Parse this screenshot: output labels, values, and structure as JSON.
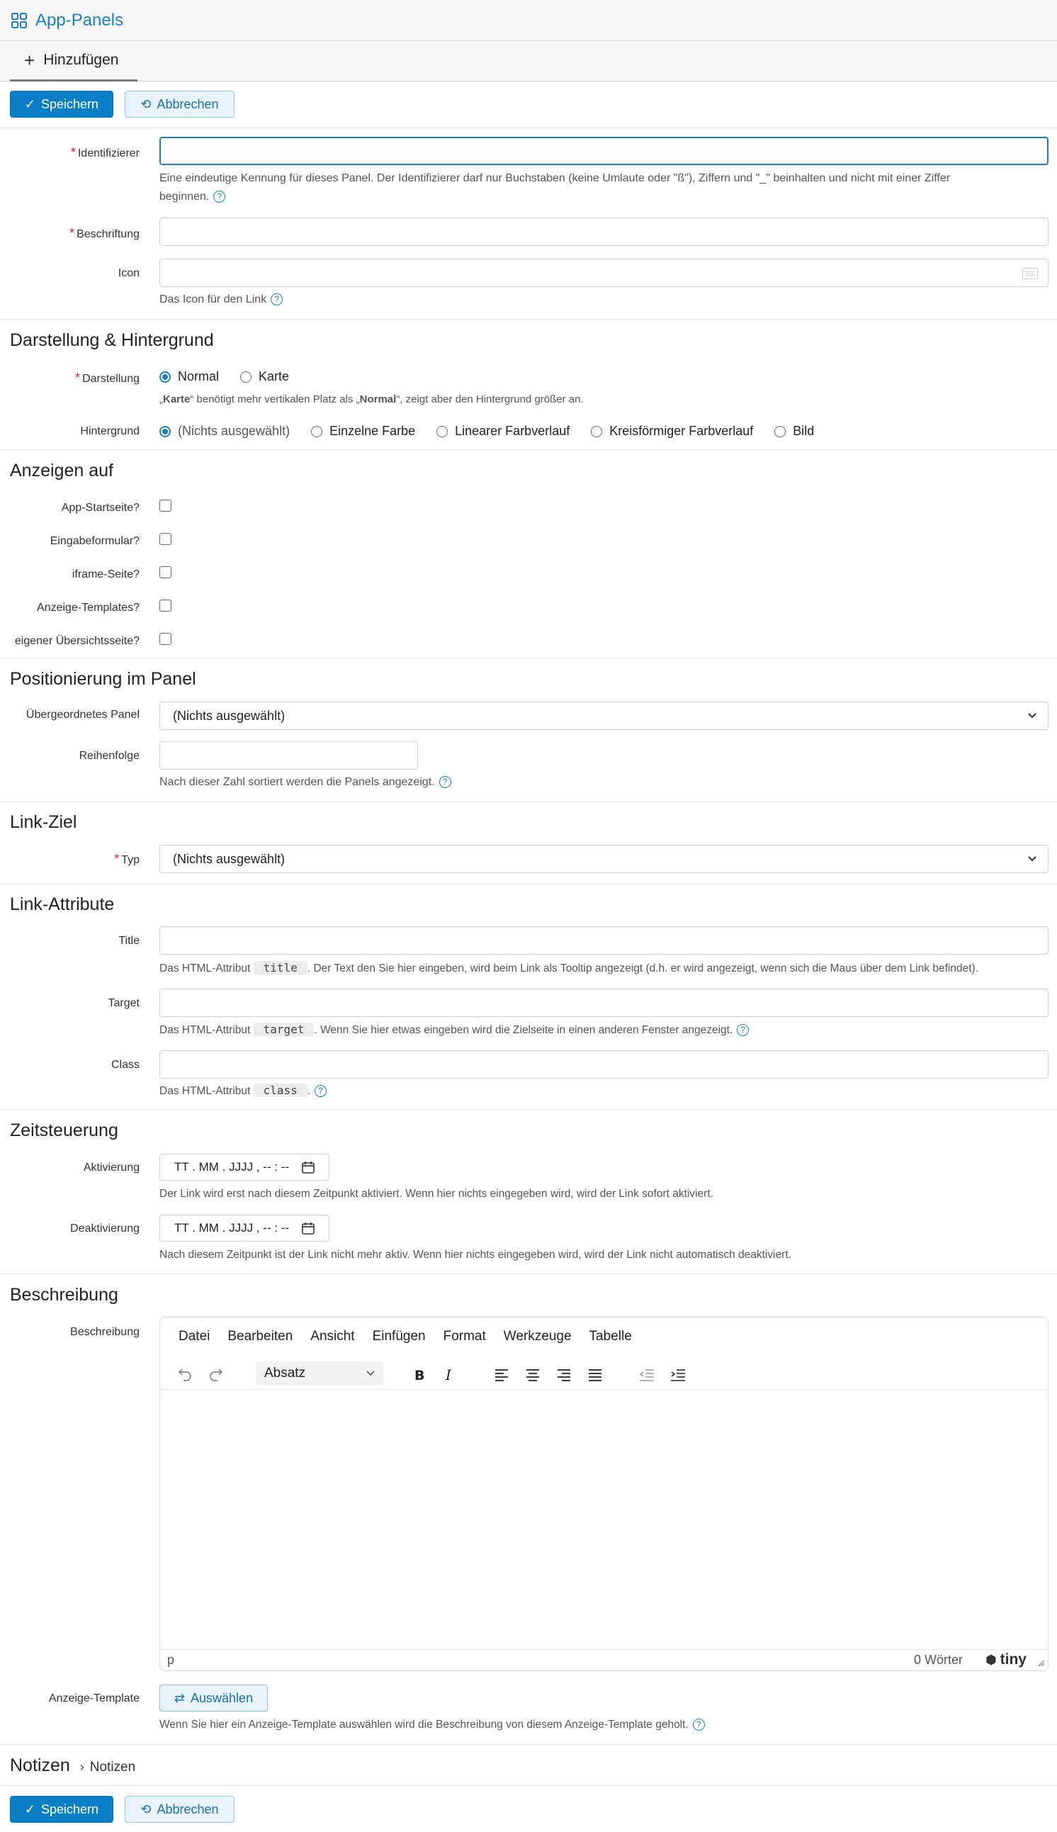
{
  "app": {
    "title": "App-Panels"
  },
  "tabs": [
    {
      "label": "Hinzufügen"
    }
  ],
  "toolbar": {
    "save_label": "Speichern",
    "cancel_label": "Abbrechen"
  },
  "fields": {
    "identifier": {
      "label": "Identifizierer",
      "value": "",
      "help": "Eine eindeutige Kennung für dieses Panel. Der Identifizierer darf nur Buchstaben (keine Umlaute oder \"ß\"), Ziffern und \"_\" beinhalten und nicht mit einer Ziffer",
      "help2": "beginnen."
    },
    "caption": {
      "label": "Beschriftung",
      "value": ""
    },
    "icon": {
      "label": "Icon",
      "value": "",
      "help": "Das Icon für den Link"
    }
  },
  "sections": {
    "display": "Darstellung & Hintergrund",
    "show_on": "Anzeigen auf",
    "position": "Positionierung im Panel",
    "link_target": "Link-Ziel",
    "link_attrs": "Link-Attribute",
    "timing": "Zeitsteuerung",
    "description": "Beschreibung",
    "notes": "Notizen"
  },
  "display": {
    "label": "Darstellung",
    "options": [
      "Normal",
      "Karte"
    ],
    "selected": "Normal",
    "help_pre": "„",
    "help_karte": "Karte",
    "help_mid": "“ benötigt mehr vertikalen Platz als „",
    "help_normal": "Normal",
    "help_post": "“, zeigt aber den Hintergrund größer an."
  },
  "background": {
    "label": "Hintergrund",
    "options": [
      "(Nichts ausgewählt)",
      "Einzelne Farbe",
      "Linearer Farbverlauf",
      "Kreisförmiger Farbverlauf",
      "Bild"
    ],
    "selected": "(Nichts ausgewählt)"
  },
  "show_on": [
    {
      "label": "App-Startseite?",
      "checked": false
    },
    {
      "label": "Eingabeformular?",
      "checked": false
    },
    {
      "label": "iframe-Seite?",
      "checked": false
    },
    {
      "label": "Anzeige-Templates?",
      "checked": false
    },
    {
      "label": "eigener Übersichtsseite?",
      "checked": false
    }
  ],
  "position": {
    "parent_label": "Übergeordnetes Panel",
    "parent_value": "(Nichts ausgewählt)",
    "order_label": "Reihenfolge",
    "order_value": "",
    "order_help": "Nach dieser Zahl sortiert werden die Panels angezeigt."
  },
  "link_target": {
    "type_label": "Typ",
    "type_value": "(Nichts ausgewählt)"
  },
  "link_attrs": {
    "title_label": "Title",
    "title_help_pre": "Das HTML-Attribut",
    "title_code": "title",
    "title_help_post": ". Der Text den Sie hier eingeben, wird beim Link als Tooltip angezeigt (d.h. er wird angezeigt, wenn sich die Maus über dem Link befindet).",
    "target_label": "Target",
    "target_help_pre": "Das HTML-Attribut",
    "target_code": "target",
    "target_help_post": ". Wenn Sie hier etwas eingeben wird die Zielseite in einen anderen Fenster angezeigt.",
    "class_label": "Class",
    "class_help_pre": "Das HTML-Attribut",
    "class_code": "class",
    "class_help_post": "."
  },
  "timing": {
    "activation_label": "Aktivierung",
    "activation_placeholder": "TT . MM . JJJJ ,  -- : --",
    "activation_help": "Der Link wird erst nach diesem Zeitpunkt aktiviert. Wenn hier nichts eingegeben wird, wird der Link sofort aktiviert.",
    "deactivation_label": "Deaktivierung",
    "deactivation_placeholder": "TT . MM . JJJJ ,  -- : --",
    "deactivation_help": "Nach diesem Zeitpunkt ist der Link nicht mehr aktiv. Wenn hier nichts eingegeben wird, wird der Link nicht automatisch deaktiviert."
  },
  "editor": {
    "label": "Beschreibung",
    "menu": [
      "Datei",
      "Bearbeiten",
      "Ansicht",
      "Einfügen",
      "Format",
      "Werkzeuge",
      "Tabelle"
    ],
    "block_format": "Absatz",
    "status_path": "p",
    "word_count": "0 Wörter",
    "brand": "tiny"
  },
  "template": {
    "label": "Anzeige-Template",
    "button": "Auswählen",
    "help": "Wenn Sie hier ein Anzeige-Template auswählen wird die Beschreibung von diesem Anzeige-Template geholt."
  },
  "notes": {
    "breadcrumb": "Notizen"
  },
  "colors": {
    "accent": "#1a7fc2",
    "primary_button": "#0a7fc8",
    "required": "#d8262c"
  }
}
